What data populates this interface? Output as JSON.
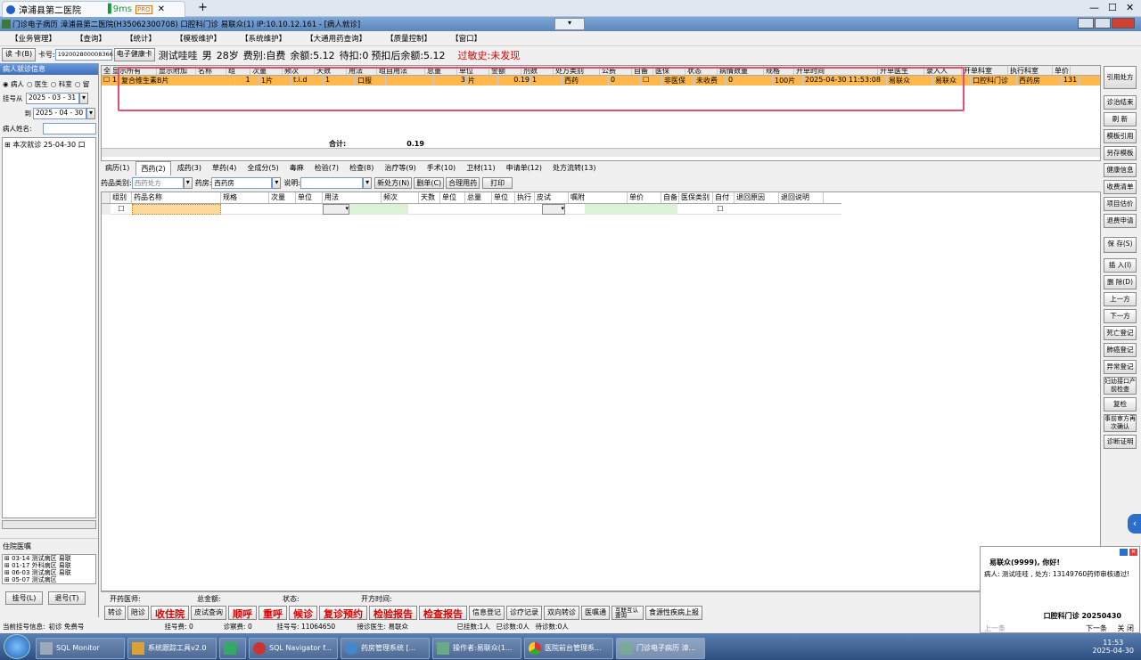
{
  "browser": {
    "tab_title": "漳浦县第二医院",
    "ping": "9ms",
    "tag": "PRO",
    "new_tab": "+",
    "minimize": "—",
    "maximize": "☐",
    "close": "✕"
  },
  "window": {
    "title": "门诊电子病历 漳浦县第二医院(H35062300708) 口腔科门诊 易联众(1) IP:10.10.12.161 - [病人就诊]"
  },
  "menu": [
    "【业务管理】",
    "【查询】",
    "【统计】",
    "【模板维护】",
    "【系统维护】",
    "【大通用药查询】",
    "【质量控制】",
    "【窗口】"
  ],
  "patient": {
    "read_card": "读 卡(B)",
    "card_label": "卡号:",
    "card_no": "192002800008366",
    "ehc": "电子健康卡",
    "name": "测试哇哇",
    "sex": "男",
    "age": "28岁",
    "fee": "费别:自费",
    "balance": "余额:5.12",
    "pending": "待扣:0",
    "after": "预扣后余额:5.12",
    "allergy": "过敏史:未发现"
  },
  "left": {
    "header": "病人就诊信息",
    "radios": [
      "病人",
      "医生",
      "科室",
      "留"
    ],
    "from_label": "挂号从",
    "from": "2025 - 03 - 31",
    "to_label": "到",
    "to": "2025 - 04 - 30",
    "name_label": "病人姓名:",
    "tree": "本次就诊 25-04-30 口",
    "ward_label": "住院医嘱",
    "ward": [
      "03-14 测试病区 易联",
      "01-17 外科病区 易联",
      "06-03 测试病区 易联",
      "05-07 测试病区"
    ],
    "btn_reg": "挂号(L)",
    "btn_ret": "退号(T)"
  },
  "grid1": {
    "headers": [
      "全",
      "显示所有",
      "显示附加",
      "名称",
      "组",
      "次量",
      "频次",
      "天数",
      "用法",
      "组自用法",
      "总量",
      "单位",
      "金额",
      "剂数",
      "处方类别",
      "公费",
      "自备",
      "医保",
      "状态",
      "病情数量",
      "规格",
      "开单时间",
      "开单医生",
      "录入人",
      "开单科室",
      "执行科室",
      "单价"
    ],
    "row": [
      "1",
      "复合维生素B片",
      "1",
      "1片",
      "t.i.d",
      "1",
      "口服",
      "",
      "3",
      "片",
      "0.19",
      "1",
      "西药",
      "0",
      "非医保",
      "未收费",
      "0",
      "100片",
      "2025-04-30 11:53:08",
      "易联众",
      "易联众",
      "口腔科门诊",
      "西药房",
      "131"
    ],
    "total_label": "合计:",
    "total": "0.19"
  },
  "tabs": [
    "病历(1)",
    "西药(2)",
    "成药(3)",
    "草药(4)",
    "全成分(5)",
    "毒麻",
    "检验(7)",
    "检查(8)",
    "治疗等(9)",
    "手术(10)",
    "卫材(11)",
    "申请单(12)",
    "处方流转(13)"
  ],
  "filter": {
    "type_label": "药品类别:",
    "type": "西药处方",
    "pharm_label": "药房:",
    "pharm": "西药房",
    "note_label": "说明:",
    "b1": "新处方(N)",
    "b2": "删单(C)",
    "b3": "合理用药",
    "b4": "打印"
  },
  "grid2": {
    "headers": [
      "组别",
      "药品名称",
      "规格",
      "次量",
      "单位",
      "用法",
      "频次",
      "天数",
      "单位",
      "总量",
      "单位",
      "执行",
      "皮试",
      "嘱附",
      "单价",
      "自备",
      "医保类别",
      "自付",
      "退回原因",
      "退回说明"
    ]
  },
  "footer": {
    "doctor": "开药医师:",
    "amount": "总金额:",
    "state": "状态:",
    "time": "开方时间:"
  },
  "bottom_btns": [
    "转诊",
    "陪诊",
    "收住院",
    "皮试查询",
    "顺呼",
    "重呼",
    "候诊",
    "复诊预约",
    "检验报告",
    "检查报告",
    "信息登记",
    "诊疗记录",
    "双向转诊",
    "医嘱通",
    "互联互认查询",
    "食源性疾病上报"
  ],
  "status": {
    "s1": "当前挂号信息:",
    "s2": "初诊 免费号",
    "s3": "挂号费: 0",
    "s4": "诊察费: 0",
    "s5": "挂号号: 11064650",
    "s6": "接诊医生: 易联众",
    "s7": "已挂数:1人",
    "s8": "已诊数:0人",
    "s9": "待诊数:0人"
  },
  "right_btns": [
    "引用处方",
    "诊治结束",
    "刷 新",
    "模板引用",
    "另存模板",
    "健康信息",
    "收费清单",
    "项目估价",
    "退费申请",
    "保 存(S)",
    "插 入(I)",
    "删 除(D)",
    "上一方",
    "下一方",
    "死亡登记",
    "肺癌登记",
    "异常登记",
    "妇幼接口产前检查",
    "复检",
    "事前审方再次确认",
    "诊断证明"
  ],
  "notify": {
    "greet": "易联众(9999), 你好!",
    "msg": "病人: 测试哇哇 , 处方: 13149760药师审核通过!",
    "dept": "口腔科门诊 20250430",
    "prev": "上一条",
    "next": "下一条",
    "close": "关 闭"
  },
  "taskbar": {
    "items": [
      "SQL Monitor",
      "系统跟踪工具v2.0",
      "",
      "SQL Navigator f...",
      "药房管理系统 [...",
      "操作者:易联众(1...",
      "医院前台管理系...",
      "门诊电子病历 漳..."
    ],
    "time": "11:53",
    "date": "2025-04-30"
  }
}
